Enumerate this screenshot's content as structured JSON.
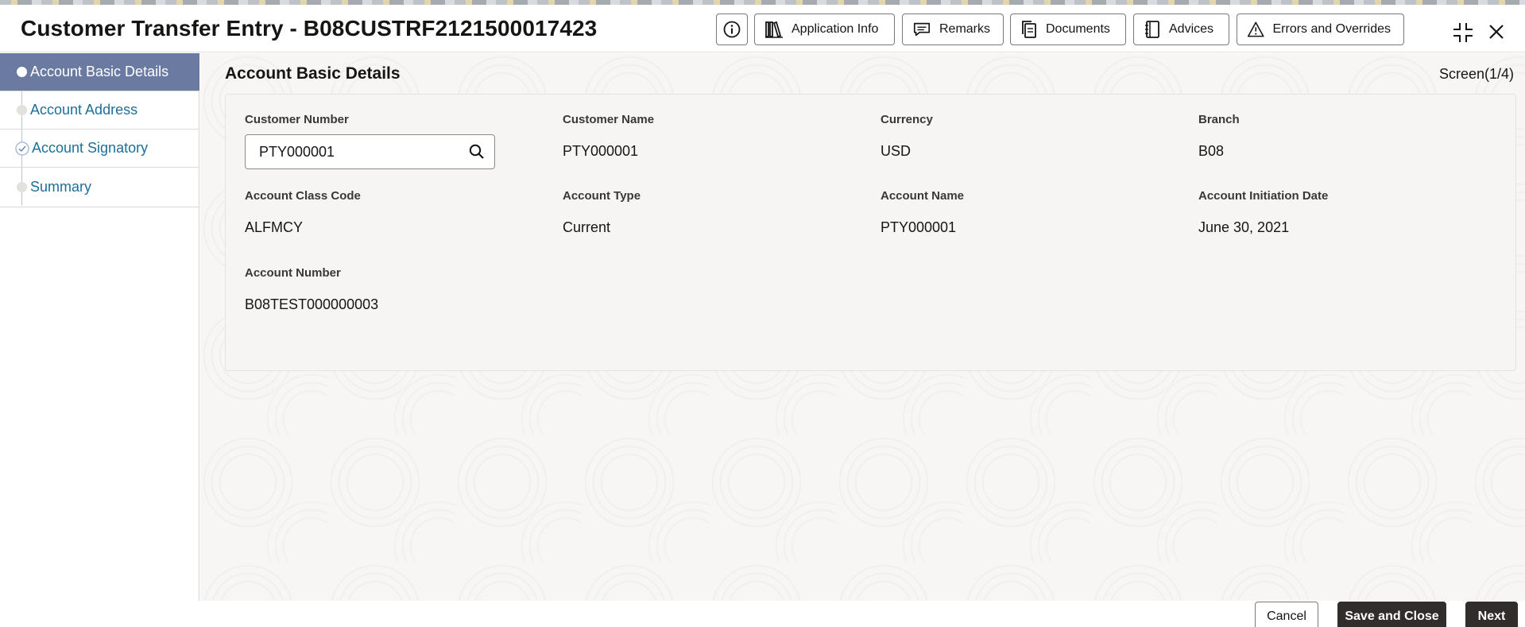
{
  "header": {
    "title": "Customer Transfer Entry - B08CUSTRF2121500017423",
    "buttons": {
      "application_info": "Application Info",
      "remarks": "Remarks",
      "documents": "Documents",
      "advices": "Advices",
      "errors_overrides": "Errors and Overrides"
    }
  },
  "sidebar": {
    "items": [
      {
        "label": "Account Basic Details",
        "state": "active"
      },
      {
        "label": "Account Address",
        "state": "pending"
      },
      {
        "label": "Account Signatory",
        "state": "completed"
      },
      {
        "label": "Summary",
        "state": "pending"
      }
    ]
  },
  "main": {
    "section_title": "Account Basic Details",
    "screen_indicator": "Screen(1/4)",
    "fields": {
      "customer_number": {
        "label": "Customer Number",
        "value": "PTY000001"
      },
      "customer_name": {
        "label": "Customer Name",
        "value": "PTY000001"
      },
      "currency": {
        "label": "Currency",
        "value": "USD"
      },
      "branch": {
        "label": "Branch",
        "value": "B08"
      },
      "account_class_code": {
        "label": "Account Class Code",
        "value": "ALFMCY"
      },
      "account_type": {
        "label": "Account Type",
        "value": "Current"
      },
      "account_name": {
        "label": "Account Name",
        "value": "PTY000001"
      },
      "account_initiation_date": {
        "label": "Account Initiation Date",
        "value": "June 30, 2021"
      },
      "account_number": {
        "label": "Account Number",
        "value": "B08TEST000000003"
      }
    }
  },
  "footer": {
    "cancel": "Cancel",
    "save_close": "Save and Close",
    "next": "Next"
  },
  "colors": {
    "sidebar_active": "#6b7aa1",
    "link": "#1d6f9a",
    "primary_button": "#312d2a"
  }
}
